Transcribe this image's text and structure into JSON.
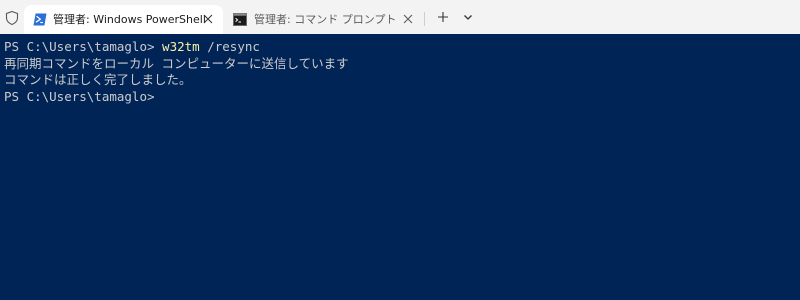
{
  "tabs": [
    {
      "label": "管理者: Windows PowerShell",
      "icon": "powershell-icon",
      "active": true
    },
    {
      "label": "管理者: コマンド プロンプト",
      "icon": "command-prompt-icon",
      "active": false
    }
  ],
  "terminal": {
    "line1_prompt": "PS C:\\Users\\tamaglo> ",
    "line1_cmd": "w32tm",
    "line1_args": " /resync",
    "line2": "再同期コマンドをローカル コンピューターに送信しています",
    "line3": "コマンドは正しく完了しました。",
    "line4_prompt": "PS C:\\Users\\tamaglo>"
  },
  "colors": {
    "terminal_background": "#012456",
    "terminal_text": "#cccccc",
    "command_highlight": "#f9f1a5",
    "tabbar_background": "#f3f3f3",
    "active_tab_background": "#ffffff",
    "powershell_icon": "#2a6fd6"
  }
}
